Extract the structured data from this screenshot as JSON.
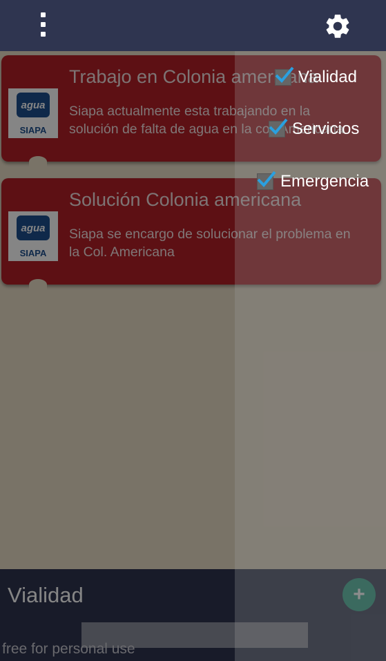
{
  "header": {
    "menu_icon": "overflow-menu-icon",
    "settings_icon": "gear-icon"
  },
  "cards": [
    {
      "title": "Trabajo en Colonia americana",
      "body": "Siapa actualmente esta trabajando en la solución de falta de agua en la col. Americana",
      "logo_text": "agua",
      "logo_brand": "SIAPA"
    },
    {
      "title": "Solución Colonia americana",
      "body": "Siapa se encargo de solucionar el problema en la Col. Americana",
      "logo_text": "agua",
      "logo_brand": "SIAPA"
    }
  ],
  "filters": [
    {
      "label": "Vialidad",
      "checked": true
    },
    {
      "label": "Servicios",
      "checked": true
    },
    {
      "label": "Emergencia",
      "checked": true
    }
  ],
  "bottom": {
    "title": "Vialidad",
    "fab_label": "+",
    "watermark": "free for personal use"
  },
  "colors": {
    "header": "#2f3550",
    "card": "#b22028",
    "background": "#e8dcc6",
    "fab": "#2aa789",
    "check": "#2aa0e0"
  }
}
